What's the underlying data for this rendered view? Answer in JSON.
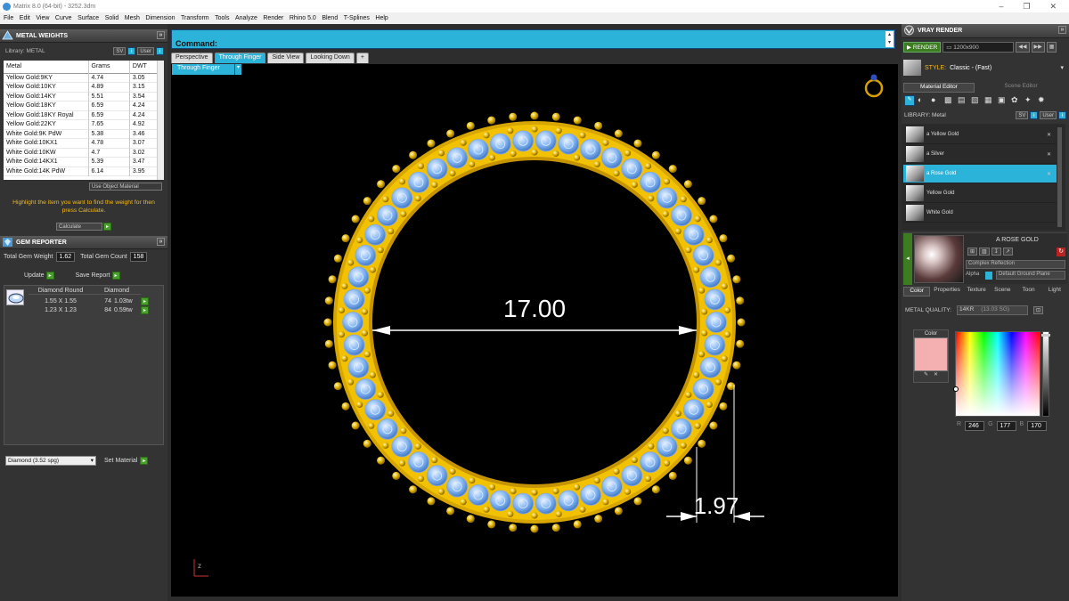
{
  "window": {
    "title": "Matrix 8.0 (64-bit) - 3252.3dm",
    "controls": [
      "–",
      "❐",
      "✕"
    ]
  },
  "menu": [
    "File",
    "Edit",
    "View",
    "Curve",
    "Surface",
    "Solid",
    "Mesh",
    "Dimension",
    "Transform",
    "Tools",
    "Analyze",
    "Render",
    "Rhino 5.0",
    "Blend",
    "T-Splines",
    "Help"
  ],
  "metal_weights": {
    "title": "METAL WEIGHTS",
    "library_label": "Library: METAL",
    "btn_sv": "SV",
    "btn_user": "User",
    "columns": [
      "Metal",
      "Grams",
      "DWT"
    ],
    "rows": [
      [
        "Yellow Gold:9KY",
        "4.74",
        "3.05"
      ],
      [
        "Yellow Gold:10KY",
        "4.89",
        "3.15"
      ],
      [
        "Yellow Gold:14KY",
        "5.51",
        "3.54"
      ],
      [
        "Yellow Gold:18KY",
        "6.59",
        "4.24"
      ],
      [
        "Yellow Gold:18KY Royal",
        "6.59",
        "4.24"
      ],
      [
        "Yellow Gold:22KY",
        "7.65",
        "4.92"
      ],
      [
        "White Gold:9K PdW",
        "5.38",
        "3.46"
      ],
      [
        "White Gold:10KX1",
        "4.78",
        "3.07"
      ],
      [
        "White Gold:10KW",
        "4.7",
        "3.02"
      ],
      [
        "White Gold:14KX1",
        "5.39",
        "3.47"
      ],
      [
        "White Gold:14K PdW",
        "6.14",
        "3.95"
      ]
    ],
    "use_object_material": "Use Object Material",
    "hint": "Highlight the item you want to find the weight for then press Calculate.",
    "calculate": "Calculate"
  },
  "gem_reporter": {
    "title": "GEM REPORTER",
    "total_weight_label": "Total Gem Weight",
    "total_weight": "1.62",
    "total_count_label": "Total Gem Count",
    "total_count": "158",
    "update": "Update",
    "save_report": "Save Report",
    "col_shape": "Diamond Round",
    "col_type": "Diamond",
    "rows": [
      {
        "size": "1.55 X 1.55",
        "count": "74",
        "weight": "1.03tw"
      },
      {
        "size": "1.23 X 1.23",
        "count": "84",
        "weight": "0.59tw"
      }
    ],
    "material_select": "Diamond   (3.52 spg)",
    "set_material": "Set Material"
  },
  "command": {
    "label": "Command:"
  },
  "viewport_tabs": [
    {
      "label": "Perspective",
      "active": false
    },
    {
      "label": "Through Finger",
      "active": true
    },
    {
      "label": "Side View",
      "active": false
    },
    {
      "label": "Looking Down",
      "active": false
    },
    {
      "label": "+",
      "active": false
    }
  ],
  "viewport": {
    "subtab": "Through Finger",
    "inner_dim": "17.00",
    "width_dim": "1.97",
    "axis_label": "z"
  },
  "vray": {
    "title": "VRAY RENDER",
    "render": "RENDER",
    "resolution": "1200x900",
    "style_label": "STYLE:",
    "style_value": "Classic - (Fast)",
    "tab_material": "Material Editor",
    "tab_scene": "Scene Editor",
    "library_label": "LIBRARY: Metal",
    "materials": [
      {
        "label": "a Yellow Gold",
        "selected": false,
        "closable": true
      },
      {
        "label": "a Silver",
        "selected": false,
        "closable": true
      },
      {
        "label": "a Rose Gold",
        "selected": true,
        "closable": true
      },
      {
        "label": "Yellow Gold",
        "selected": false,
        "closable": false
      },
      {
        "label": "White Gold",
        "selected": false,
        "closable": false
      }
    ],
    "preview_title": "A ROSE GOLD",
    "complex_reflection": "Complex Reflection",
    "alpha": "Alpha",
    "ground": "Default Ground Plane",
    "prop_tabs": [
      "Color",
      "Properties",
      "Texture",
      "Scene",
      "Toon",
      "Light"
    ],
    "metal_quality_label": "METAL QUALITY:",
    "metal_quality_value": "14KR",
    "metal_quality_extra": "(13.03 SG)",
    "color_label": "Color",
    "swatch": "#f4b0b0",
    "rgb": {
      "r": "246",
      "g": "177",
      "b": "170"
    }
  },
  "colors": {
    "accent": "#2bb3d9",
    "gold": "#f2c200",
    "gem": "#7fb3f0"
  }
}
